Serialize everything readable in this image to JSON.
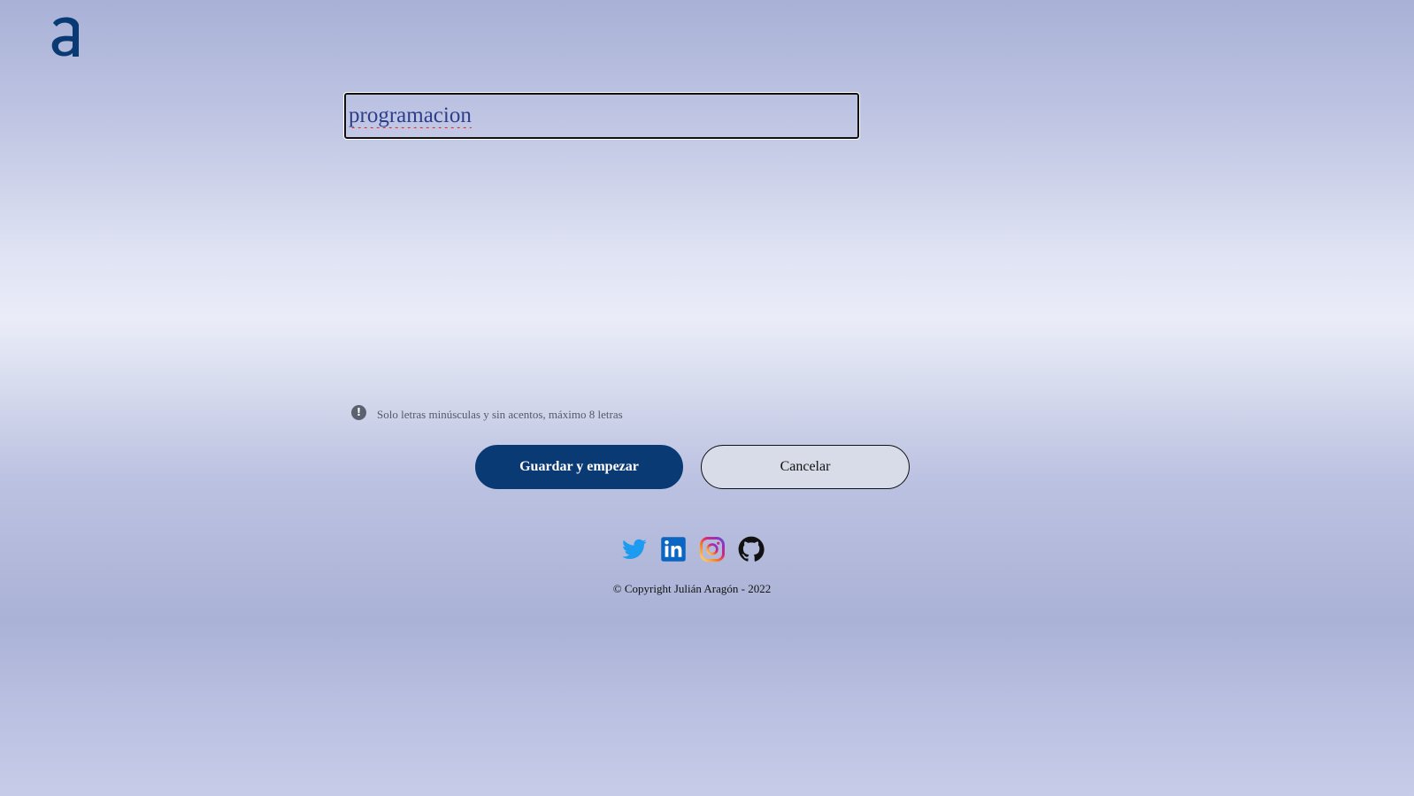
{
  "logo": {
    "glyph": "a",
    "color": "#0a3a74"
  },
  "word_input": {
    "value": "programacion",
    "text_color": "#2d3f8a"
  },
  "hint": {
    "icon": "exclamation-circle-icon",
    "icon_glyph": "!",
    "text": "Solo letras minúsculas y sin acentos, máximo 8 letras"
  },
  "actions": {
    "save_label": "Guardar y empezar",
    "cancel_label": "Cancelar",
    "primary_color": "#0a3a74"
  },
  "social": {
    "items": [
      {
        "name": "twitter",
        "icon": "twitter-icon",
        "color": "#1d9bf0"
      },
      {
        "name": "linkedin",
        "icon": "linkedin-icon",
        "color": "#0a66c2"
      },
      {
        "name": "instagram",
        "icon": "instagram-icon",
        "color": "#e1306c"
      },
      {
        "name": "github",
        "icon": "github-icon",
        "color": "#111111"
      }
    ]
  },
  "footer": {
    "copyright": "© Copyright Julián Aragón - 2022"
  }
}
